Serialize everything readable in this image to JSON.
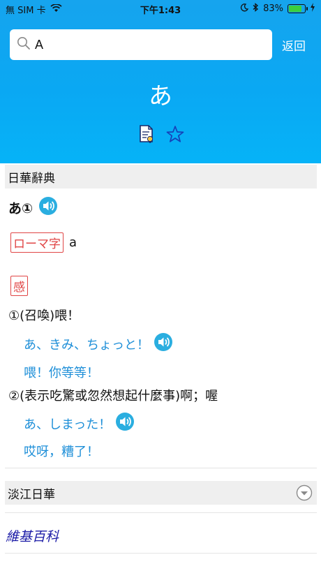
{
  "status_bar": {
    "carrier": "無 SIM 卡",
    "time": "下午1:43",
    "battery": "83%",
    "battery_level": 0.83
  },
  "search": {
    "value": "A",
    "back_label": "返回"
  },
  "headword": "あ",
  "sections": {
    "dict1": "日華辭典",
    "dict2": "淡江日華",
    "wiki": "維基百科"
  },
  "entry": {
    "title": "あ①",
    "roma_tag": "ローマ字",
    "roma_value": "a",
    "pos_tag": "感",
    "definitions": [
      {
        "text": "①(召喚)喂！",
        "example_jp": "あ、きみ、ちょっと！",
        "example_zh": "喂！你等等！"
      },
      {
        "text": "②(表示吃驚或忽然想起什麼事)啊；喔",
        "example_jp": "あ、しまった！",
        "example_zh": "哎呀，糟了！"
      }
    ]
  },
  "colors": {
    "header": "#0aa8f3",
    "accent_blue": "#1e8fd8",
    "tag_red": "#e04545",
    "speaker": "#2aaee0"
  }
}
